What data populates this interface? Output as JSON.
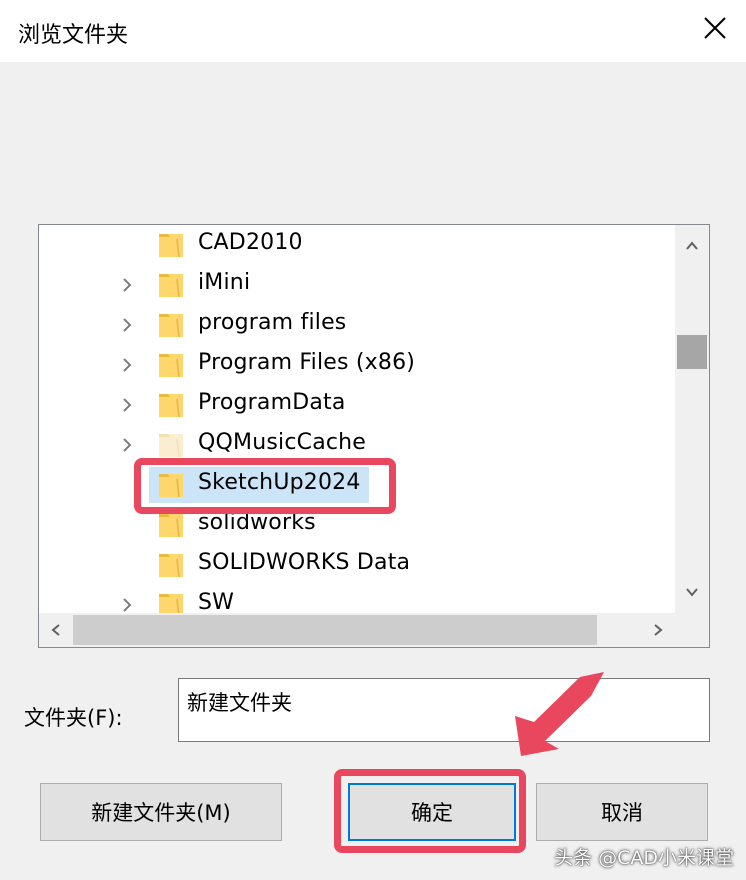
{
  "dialog": {
    "title": "浏览文件夹"
  },
  "tree": {
    "items": [
      {
        "label": "CAD2010",
        "expandable": false,
        "selected": false
      },
      {
        "label": "iMini",
        "expandable": true,
        "selected": false
      },
      {
        "label": "program files",
        "expandable": true,
        "selected": false
      },
      {
        "label": "Program Files (x86)",
        "expandable": true,
        "selected": false
      },
      {
        "label": "ProgramData",
        "expandable": true,
        "selected": false
      },
      {
        "label": "QQMusicCache",
        "expandable": true,
        "selected": false,
        "faded": true
      },
      {
        "label": "SketchUp2024",
        "expandable": false,
        "selected": true
      },
      {
        "label": "solidworks",
        "expandable": false,
        "selected": false
      },
      {
        "label": "SOLIDWORKS Data",
        "expandable": false,
        "selected": false
      },
      {
        "label": "SW",
        "expandable": true,
        "selected": false
      }
    ]
  },
  "folder_field": {
    "label": "文件夹(F):",
    "value": "新建文件夹"
  },
  "buttons": {
    "new_folder": "新建文件夹(M)",
    "ok": "确定",
    "cancel": "取消"
  },
  "watermark": "头条 @CAD小米课堂",
  "colors": {
    "highlight": "#e8475e",
    "selection": "#cce4f7",
    "folder": "#ffd66b",
    "accent": "#0078d7"
  }
}
